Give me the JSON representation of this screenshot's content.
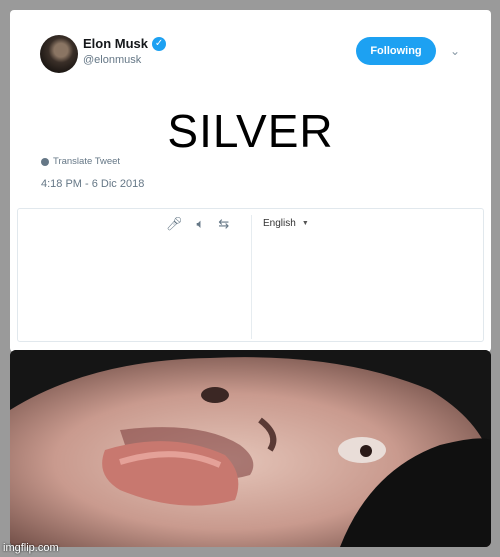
{
  "tweet": {
    "author_name": "Elon Musk",
    "handle": "@elonmusk",
    "follow_button_label": "Following",
    "text": "SILVER",
    "translate_label": "Translate Tweet",
    "timestamp": "4:18 PM - 6 Dic 2018",
    "verified_icon": "verified-check-icon",
    "chevron_icon": "chevron-down-icon"
  },
  "translator": {
    "target_language": "English",
    "icons": [
      "microphone-icon",
      "speaker-icon",
      "swap-icon"
    ]
  },
  "watermark": "imgflip.com",
  "colors": {
    "accent": "#1da1f2",
    "background": "#9a9a9a",
    "muted_text": "#657786"
  }
}
